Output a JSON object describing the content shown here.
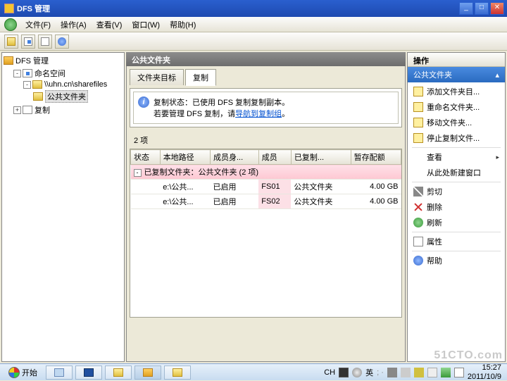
{
  "window": {
    "title": "DFS 管理"
  },
  "menu": {
    "file": "文件(F)",
    "action": "操作(A)",
    "view": "查看(V)",
    "window": "窗口(W)",
    "help": "帮助(H)"
  },
  "tree": {
    "root": "DFS 管理",
    "ns": "命名空间",
    "share": "\\\\uhn.cn\\sharefiles",
    "folder": "公共文件夹",
    "repl": "复制"
  },
  "center": {
    "title": "公共文件夹",
    "tabs": {
      "targets": "文件夹目标",
      "replication": "复制"
    },
    "info_line1_pre": "复制状态：已使用 DFS 复制复制副本。",
    "info_line2_pre": "若要管理 DFS 复制，请",
    "info_link": "导航到复制组",
    "info_line2_post": "。",
    "count_label": "2 项",
    "columns": {
      "state": "状态",
      "path": "本地路径",
      "membership": "成员身...",
      "member": "成员",
      "replicated": "已复制...",
      "quota": "暂存配额"
    },
    "group_label": "已复制文件夹：公共文件夹 (2 项)",
    "rows": [
      {
        "path": "e:\\公共...",
        "membership": "已启用",
        "member": "FS01",
        "replicated": "公共文件夹",
        "quota": "4.00 GB"
      },
      {
        "path": "e:\\公共...",
        "membership": "已启用",
        "member": "FS02",
        "replicated": "公共文件夹",
        "quota": "4.00 GB"
      }
    ]
  },
  "actions": {
    "title": "操作",
    "subtitle": "公共文件夹",
    "items": {
      "add_target": "添加文件夹目...",
      "rename": "重命名文件夹...",
      "move": "移动文件夹...",
      "stop_repl": "停止复制文件...",
      "view": "查看",
      "new_window": "从此处新建窗口",
      "cut": "剪切",
      "delete": "删除",
      "refresh": "刷新",
      "properties": "属性",
      "help": "帮助"
    }
  },
  "taskbar": {
    "start": "开始",
    "ime1": "CH",
    "ime2": "英",
    "time": "15:27",
    "date": "2011/10/9"
  },
  "watermark": "51CTO.com"
}
